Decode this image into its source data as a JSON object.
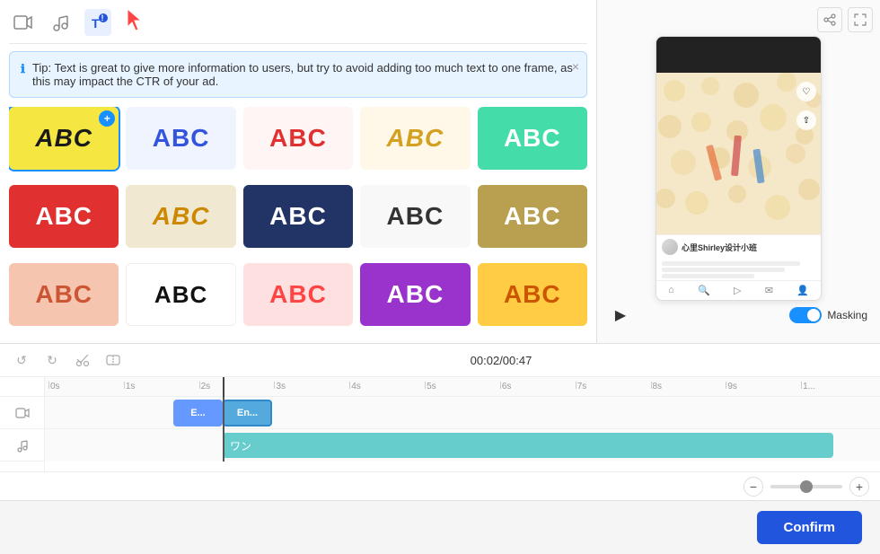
{
  "toolbar": {
    "video_icon": "▶",
    "audio_icon": "♪",
    "info_icon": "ℹ",
    "cursor_icon": "cursor"
  },
  "tip": {
    "icon": "ℹ",
    "text": "Tip: Text is great to give more information to users, but try to avoid adding too much text to one frame, as this may impact the CTR of your ad.",
    "close": "×"
  },
  "styles": [
    {
      "id": 1,
      "label": "ABC",
      "class": "s1",
      "selected": true
    },
    {
      "id": 2,
      "label": "ABC",
      "class": "s2"
    },
    {
      "id": 3,
      "label": "ABC",
      "class": "s3"
    },
    {
      "id": 4,
      "label": "ABC",
      "class": "s4"
    },
    {
      "id": 5,
      "label": "ABC",
      "class": "s5"
    },
    {
      "id": 6,
      "label": "ABC",
      "class": "s6"
    },
    {
      "id": 7,
      "label": "ABC",
      "class": "s7"
    },
    {
      "id": 8,
      "label": "ABC",
      "class": "s8"
    },
    {
      "id": 9,
      "label": "ABC",
      "class": "s9"
    },
    {
      "id": 10,
      "label": "ABC",
      "class": "s10"
    },
    {
      "id": 11,
      "label": "ABC",
      "class": "s11"
    },
    {
      "id": 12,
      "label": "ABC",
      "class": "s12"
    },
    {
      "id": 13,
      "label": "ABC",
      "class": "s13"
    },
    {
      "id": 14,
      "label": "ABC",
      "class": "s14"
    },
    {
      "id": 15,
      "label": "ABC",
      "class": "s15"
    }
  ],
  "timeline": {
    "current_time": "00:02",
    "total_time": "00:47",
    "time_display": "00:02/00:47",
    "ruler_marks": [
      "0s",
      "1s",
      "2s",
      "3s",
      "4s",
      "5s",
      "6s",
      "7s",
      "8s",
      "9s",
      "1..."
    ],
    "video_clip1_label": "E...",
    "video_clip2_label": "En...",
    "audio_clip_label": "ワン",
    "undo": "↺",
    "redo": "↻",
    "cut": "✂",
    "split": "⊡"
  },
  "preview": {
    "masking_label": "Masking",
    "play_icon": "▶",
    "username": "心里Shirley设计小班"
  },
  "confirm_button": "Confirm"
}
